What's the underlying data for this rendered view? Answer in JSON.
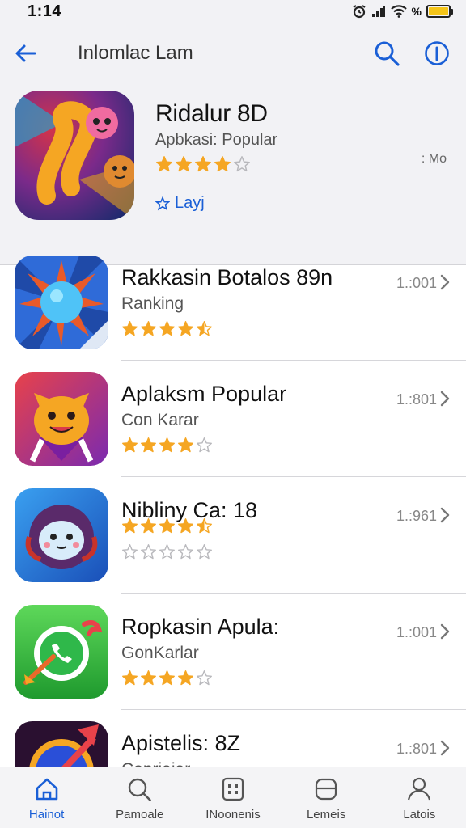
{
  "status_bar": {
    "time": "1:14",
    "signal_text": "%"
  },
  "nav": {
    "title": "Inlomlac Lam"
  },
  "featured": {
    "name": "Ridalur 8D",
    "subtitle": "Apbkasi: Popular",
    "rating": 4,
    "size": ": Mo",
    "action_label": "Layj"
  },
  "list": [
    {
      "name": "Rakkasin Botalos 89n",
      "subtitle": "Ranking",
      "rating": 4.5,
      "size": "1.:001"
    },
    {
      "name": "Aplaksm Popular",
      "subtitle": "Con Karar",
      "rating": 4,
      "size": "1.:801"
    },
    {
      "name": "Nibliny Ca: 18",
      "subtitle": "",
      "rating": 4.5,
      "rating2": 0,
      "size": "1.:961"
    },
    {
      "name": "Ropkasin Apula:",
      "subtitle": "GonKarlar",
      "rating": 4,
      "size": "1.:001"
    },
    {
      "name": "Apistelis: 8Z",
      "subtitle": "Conriaiar",
      "rating": 0,
      "size": "1.:801"
    }
  ],
  "tabs": [
    {
      "label": "Hainot",
      "icon": "home-icon"
    },
    {
      "label": "Pamoale",
      "icon": "search-icon"
    },
    {
      "label": "INoonenis",
      "icon": "apps-icon"
    },
    {
      "label": "Lemeis",
      "icon": "updates-icon"
    },
    {
      "label": "Latois",
      "icon": "account-icon"
    }
  ],
  "colors": {
    "accent": "#1a5fd6",
    "star": "#f5a623",
    "star_empty": "#b8b8bc"
  }
}
